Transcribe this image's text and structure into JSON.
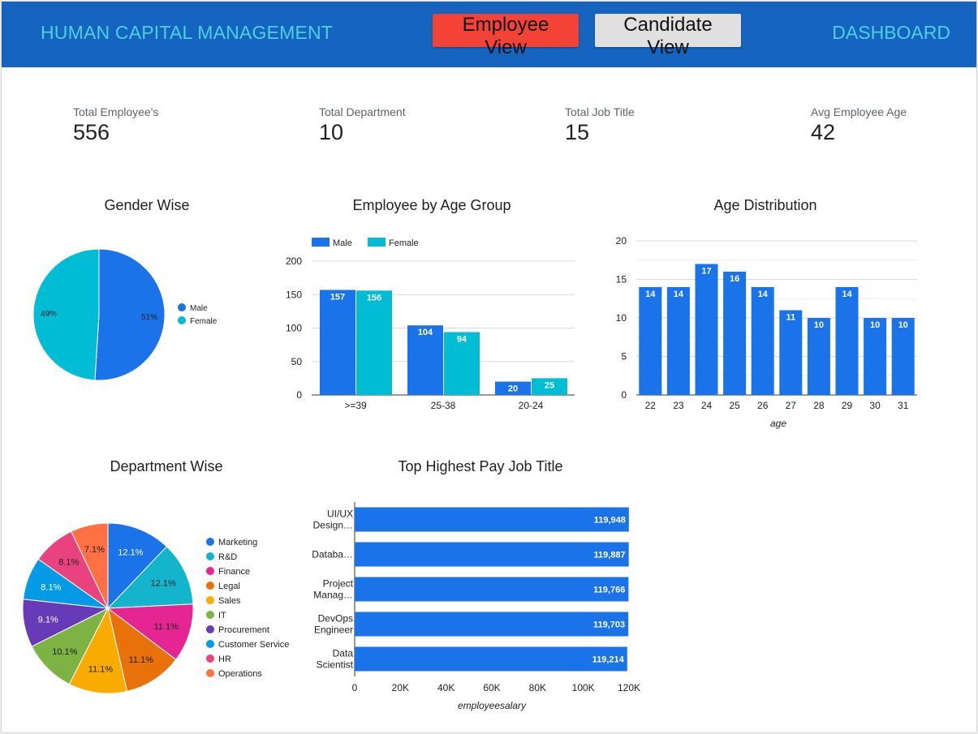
{
  "header": {
    "title": "HUMAN CAPITAL MANAGEMENT",
    "employee_view": "Employee View",
    "candidate_view": "Candidate View",
    "dashboard": "DASHBOARD"
  },
  "kpis": [
    {
      "label": "Total Employee's",
      "value": "556"
    },
    {
      "label": "Total Department",
      "value": "10"
    },
    {
      "label": "Total Job Title",
      "value": "15"
    },
    {
      "label": "Avg Employee Age",
      "value": "42"
    }
  ],
  "colors": {
    "blue": "#1a73e8",
    "teal": "#00bcd4",
    "header": "#1565c0",
    "header_text": "#4dd0e1",
    "btn_active": "#f44336"
  },
  "chart_data": [
    {
      "id": "gender",
      "type": "pie",
      "title": "Gender Wise",
      "labels": [
        "Male",
        "Female"
      ],
      "values": [
        51,
        49
      ],
      "value_labels": [
        "51%",
        "49%"
      ],
      "colors": [
        "#1a73e8",
        "#00bcd4"
      ],
      "legend": "right"
    },
    {
      "id": "age_group",
      "type": "bar",
      "title": "Employee by Age Group",
      "categories": [
        ">=39",
        "25-38",
        "20-24"
      ],
      "series": [
        {
          "name": "Male",
          "values": [
            157,
            104,
            20
          ],
          "color": "#1a73e8"
        },
        {
          "name": "Female",
          "values": [
            156,
            94,
            25
          ],
          "color": "#00bcd4"
        }
      ],
      "ylim": [
        0,
        200
      ],
      "yticks": [
        0,
        50,
        100,
        150,
        200
      ],
      "legend": "top-left",
      "grid": true
    },
    {
      "id": "age_dist",
      "type": "bar",
      "title": "Age Distribution",
      "categories": [
        "22",
        "23",
        "24",
        "25",
        "26",
        "27",
        "28",
        "29",
        "30",
        "31"
      ],
      "values": [
        14,
        14,
        17,
        16,
        14,
        11,
        10,
        14,
        10,
        10
      ],
      "xlabel": "age",
      "ylim": [
        0,
        20
      ],
      "yticks": [
        0,
        5,
        10,
        15,
        20
      ],
      "color": "#1a73e8",
      "grid": true
    },
    {
      "id": "department",
      "type": "pie",
      "title": "Department Wise",
      "labels": [
        "Marketing",
        "R&D",
        "Finance",
        "Legal",
        "Sales",
        "IT",
        "Procurement",
        "Customer Service",
        "HR",
        "Operations"
      ],
      "values": [
        12.1,
        12.1,
        11.1,
        11.1,
        11.1,
        10.1,
        9.1,
        8.1,
        8.1,
        7.1
      ],
      "value_labels": [
        "12.1%",
        "12.1%",
        "11.1%",
        "11.1%",
        "11.1%",
        "10.1%",
        "9.1%",
        "8.1%",
        "8.1%",
        "7.1%"
      ],
      "colors": [
        "#1a73e8",
        "#12b5cb",
        "#e52592",
        "#e8710a",
        "#f9ab00",
        "#7cb342",
        "#673ab7",
        "#039be5",
        "#e8437e",
        "#ff7043"
      ],
      "legend": "right"
    },
    {
      "id": "top_pay",
      "type": "bar",
      "orientation": "horizontal",
      "title": "Top Highest Pay Job Title",
      "categories": [
        [
          "UI/UX",
          "Design…"
        ],
        [
          "Databa…"
        ],
        [
          "Project",
          "Manag…"
        ],
        [
          "DevOps",
          "Engineer"
        ],
        [
          "Data",
          "Scientist"
        ]
      ],
      "values": [
        119948,
        119887,
        119766,
        119703,
        119214
      ],
      "value_labels": [
        "119,948",
        "119,887",
        "119,766",
        "119,703",
        "119,214"
      ],
      "xlabel": "employeesalary",
      "xlim": [
        0,
        120000
      ],
      "xticks": [
        0,
        20000,
        40000,
        60000,
        80000,
        100000,
        120000
      ],
      "xtick_labels": [
        "0",
        "20K",
        "40K",
        "60K",
        "80K",
        "100K",
        "120K"
      ],
      "color": "#1a73e8"
    }
  ]
}
